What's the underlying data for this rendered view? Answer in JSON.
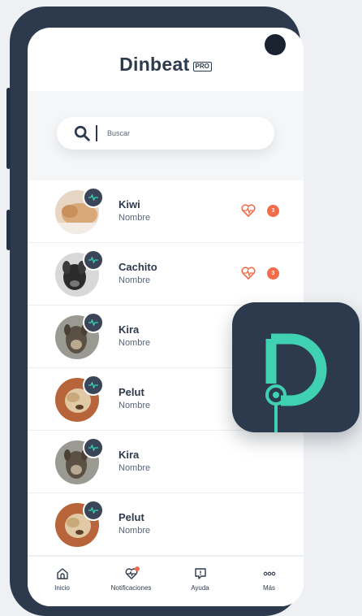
{
  "app": {
    "logo_text": "Dinbeat",
    "logo_badge": "PRO"
  },
  "search": {
    "placeholder": "Buscar",
    "icon": "search-icon"
  },
  "pets": [
    {
      "name": "Kiwi",
      "subtitle": "Nombre",
      "alert": true,
      "alert_count": "3",
      "photo": "tan-dog"
    },
    {
      "name": "Cachito",
      "subtitle": "Nombre",
      "alert": true,
      "alert_count": "3",
      "photo": "black-dog"
    },
    {
      "name": "Kira",
      "subtitle": "Nombre",
      "alert": false,
      "photo": "brindle-dog"
    },
    {
      "name": "Pelut",
      "subtitle": "Nombre",
      "alert": false,
      "photo": "shaggy-dog"
    },
    {
      "name": "Kira",
      "subtitle": "Nombre",
      "alert": false,
      "photo": "brindle-dog"
    },
    {
      "name": "Pelut",
      "subtitle": "Nombre",
      "alert": false,
      "photo": "shaggy-dog"
    }
  ],
  "tabbar": {
    "items": [
      {
        "label": "Inicio",
        "icon": "home-icon"
      },
      {
        "label": "Notificaciones",
        "icon": "notification-icon"
      },
      {
        "label": "Ayuda",
        "icon": "help-icon"
      },
      {
        "label": "Más",
        "icon": "more-icon"
      }
    ]
  },
  "colors": {
    "primary": "#2d3a4e",
    "accent": "#3fd1b2",
    "alert": "#f26b4a",
    "background": "#f4f6f8"
  }
}
